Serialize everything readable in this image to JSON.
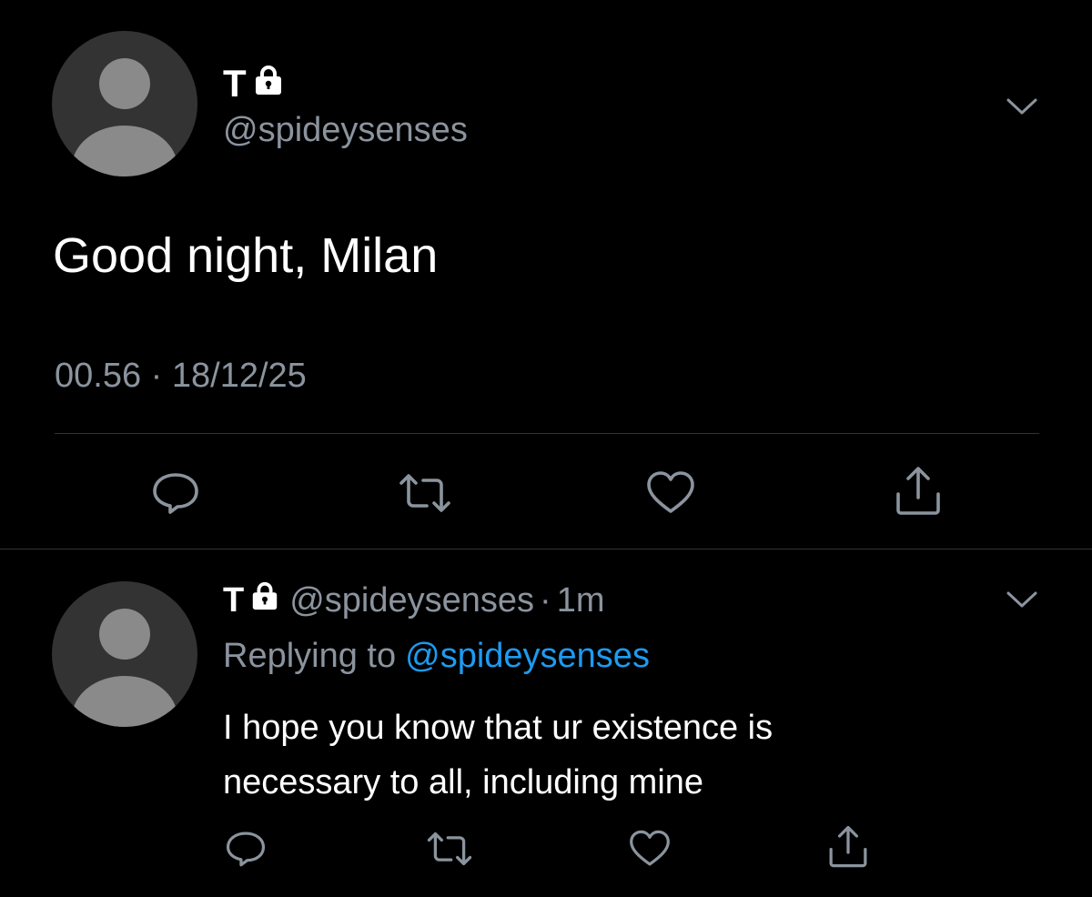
{
  "colors": {
    "background": "#000000",
    "text_primary": "#ffffff",
    "text_secondary": "#8b949e",
    "link": "#1d9bf0",
    "divider": "#2f3336",
    "icon": "#8b949e",
    "avatar_bg": "#333333",
    "avatar_silhouette": "#8a8a8a"
  },
  "main_tweet": {
    "avatar_icon": "default-profile-avatar",
    "display_name": "T",
    "lock_icon": "lock-icon",
    "handle": "@spideysenses",
    "menu_icon": "chevron-down-icon",
    "text": "Good night, Milan",
    "timestamp": "00.56 · 18/12/25",
    "actions": [
      {
        "name": "reply",
        "icon": "comment-icon"
      },
      {
        "name": "retweet",
        "icon": "retweet-icon"
      },
      {
        "name": "like",
        "icon": "heart-icon"
      },
      {
        "name": "share",
        "icon": "share-icon"
      }
    ]
  },
  "reply_tweet": {
    "avatar_icon": "default-profile-avatar",
    "display_name": "T",
    "lock_icon": "lock-icon",
    "handle": "@spideysenses",
    "separator": "·",
    "time_ago": "1m",
    "menu_icon": "chevron-down-icon",
    "replying_label": "Replying to",
    "replying_to": "@spideysenses",
    "text_lines": [
      "I hope you know that ur existence is",
      "necessary to all, including mine"
    ],
    "actions": [
      {
        "name": "reply",
        "icon": "comment-icon"
      },
      {
        "name": "retweet",
        "icon": "retweet-icon"
      },
      {
        "name": "like",
        "icon": "heart-icon"
      },
      {
        "name": "share",
        "icon": "share-icon"
      }
    ]
  }
}
